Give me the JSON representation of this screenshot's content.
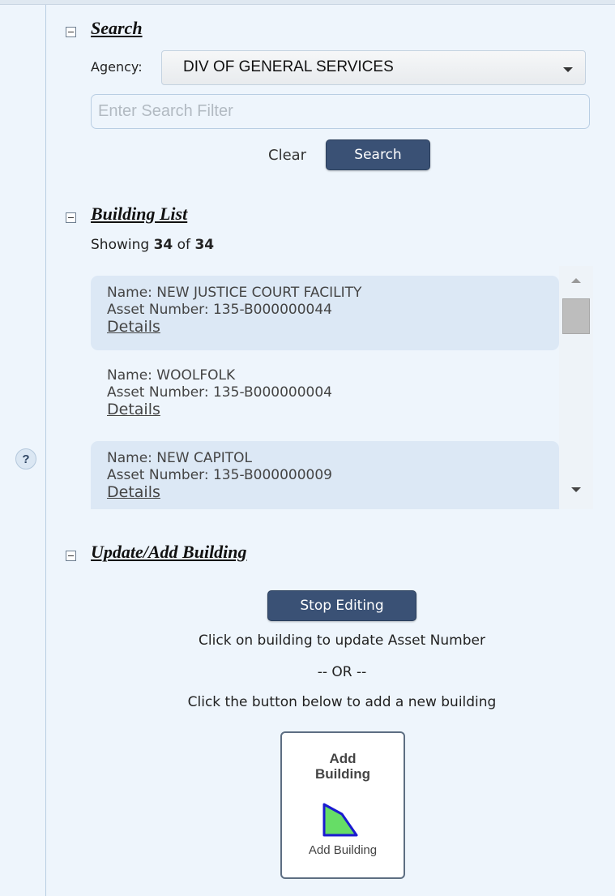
{
  "help": {
    "label": "?"
  },
  "search": {
    "title": "Search",
    "agency_label": "Agency:",
    "agency_value": "DIV OF GENERAL SERVICES",
    "filter_placeholder": "Enter Search Filter",
    "filter_value": "",
    "clear_label": "Clear",
    "search_label": "Search"
  },
  "building_list": {
    "title": "Building List",
    "showing_prefix": "Showing",
    "shown_count": "34",
    "of_word": "of",
    "total_count": "34",
    "items": [
      {
        "name": "Name: NEW JUSTICE COURT FACILITY",
        "asset": "Asset Number: 135-B000000044",
        "details": "Details"
      },
      {
        "name": "Name: WOOLFOLK",
        "asset": "Asset Number: 135-B000000004",
        "details": "Details"
      },
      {
        "name": "Name: NEW CAPITOL",
        "asset": "Asset Number: 135-B000000009",
        "details": "Details"
      }
    ]
  },
  "update_add": {
    "title": "Update/Add Building",
    "stop_editing_label": "Stop Editing",
    "instruction_1": "Click on building to update Asset Number",
    "or_text": "-- OR --",
    "instruction_2": "Click the button below to add a new building",
    "tile_title_line1": "Add",
    "tile_title_line2": "Building",
    "tile_caption": "Add Building"
  },
  "colors": {
    "button_bg": "#3a5175",
    "panel_bg": "#eef5fc",
    "polygon_fill": "#66dd66",
    "polygon_stroke": "#1a1ad0"
  }
}
